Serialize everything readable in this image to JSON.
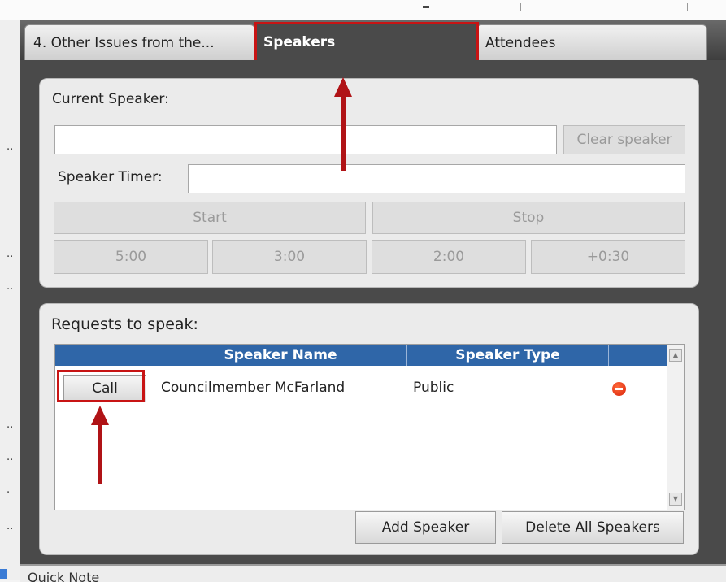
{
  "tabs": {
    "items": [
      {
        "label": "4. Other Issues from the..."
      },
      {
        "label": "Speakers"
      },
      {
        "label": "Attendees"
      }
    ]
  },
  "current_speaker": {
    "label": "Current Speaker:",
    "value": "",
    "clear_button": "Clear speaker"
  },
  "timer": {
    "label": "Speaker Timer:",
    "value": "",
    "start": "Start",
    "stop": "Stop",
    "presets": [
      "5:00",
      "3:00",
      "2:00",
      "+0:30"
    ]
  },
  "requests": {
    "title": "Requests to speak:",
    "columns": [
      "",
      "Speaker Name",
      "Speaker Type",
      ""
    ],
    "rows": [
      {
        "action": "Call",
        "name": "Councilmember McFarland",
        "type": "Public"
      }
    ],
    "add_button": "Add Speaker",
    "delete_all_button": "Delete All Speakers"
  },
  "bottom": {
    "label": "Quick Note"
  },
  "colors": {
    "highlight": "#c81414",
    "grid_header": "#2f66a8",
    "tab_bar": "#4a4a4a",
    "delete_icon": "#e2361a"
  }
}
